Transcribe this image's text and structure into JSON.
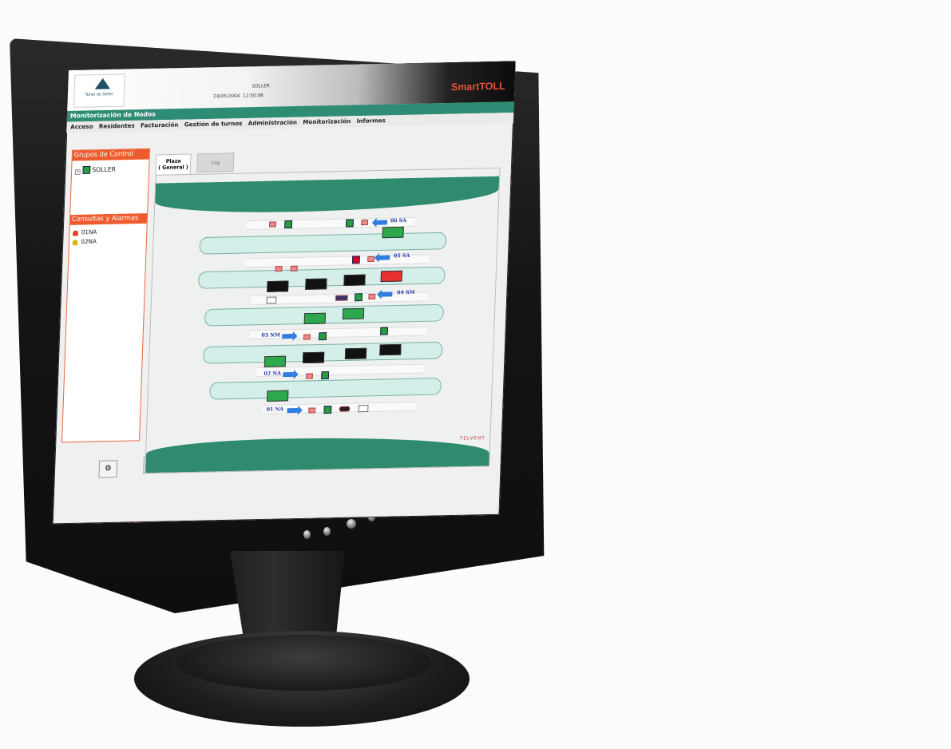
{
  "header": {
    "logo_text": "Túnel de Sóller",
    "date": "24/05/2004",
    "time": "12:50:06",
    "node": "SOLLER",
    "brand": "SmartTOLL"
  },
  "titlebar": {
    "title": "Monitorización de Nodos"
  },
  "menu": [
    "Acceso",
    "Residentes",
    "Facturación",
    "Gestión de turnos",
    "Administración",
    "Monitorización",
    "Informes"
  ],
  "left_panel": {
    "groups_title": "Grupos de Control",
    "tree_root": "SOLLER",
    "alarms_title": "Consultas y Alarmas",
    "alarms": [
      {
        "label": "01NA",
        "color": "#d9402a"
      },
      {
        "label": "02NA",
        "color": "#e0b21a"
      }
    ]
  },
  "tabs": [
    {
      "label": "Plaza",
      "sub": "( General )",
      "active": true
    },
    {
      "label": "Log",
      "active": false
    }
  ],
  "lanes": [
    "06 SA",
    "05 SA",
    "04 SM",
    "03 NM",
    "02 NA",
    "01 NA"
  ],
  "monitor": {
    "vendor_left": "TELVENT",
    "vendor_right": "TELVENT"
  },
  "colors": {
    "accent_teal": "#2e8b74",
    "alarm_orange": "#ee5b2e",
    "brand_red": "#e8503a",
    "arrow_blue": "#2f7de0"
  }
}
